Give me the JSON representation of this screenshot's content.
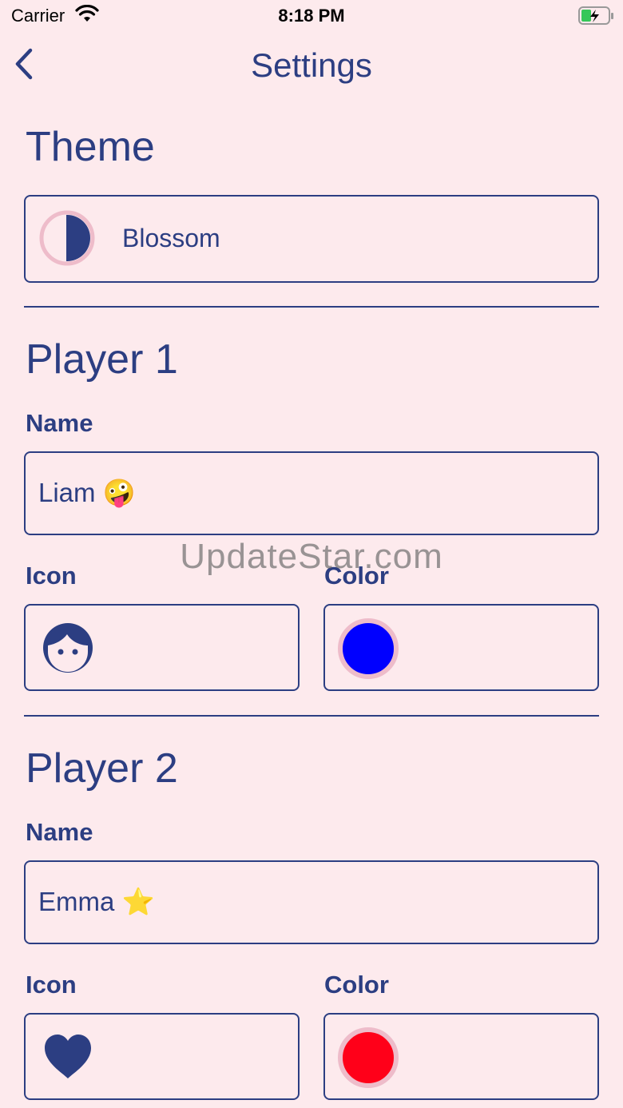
{
  "status_bar": {
    "carrier": "Carrier",
    "time": "8:18 PM"
  },
  "nav": {
    "title": "Settings",
    "back_icon": "chevron-left-icon"
  },
  "theme": {
    "heading": "Theme",
    "name": "Blossom",
    "icon": "half-circle-icon"
  },
  "player1": {
    "heading": "Player 1",
    "name_label": "Name",
    "name_value": "Liam 🤪",
    "icon_label": "Icon",
    "icon": "face-icon",
    "color_label": "Color",
    "color": "#0000ff"
  },
  "player2": {
    "heading": "Player 2",
    "name_label": "Name",
    "name_value": "Emma ⭐️",
    "icon_label": "Icon",
    "icon": "heart-icon",
    "color_label": "Color",
    "color": "#ff0019"
  },
  "watermark": "UpdateStar.com",
  "colors": {
    "background": "#fdeaed",
    "accent": "#2c3e82",
    "swatch_ring": "#eebcca"
  }
}
